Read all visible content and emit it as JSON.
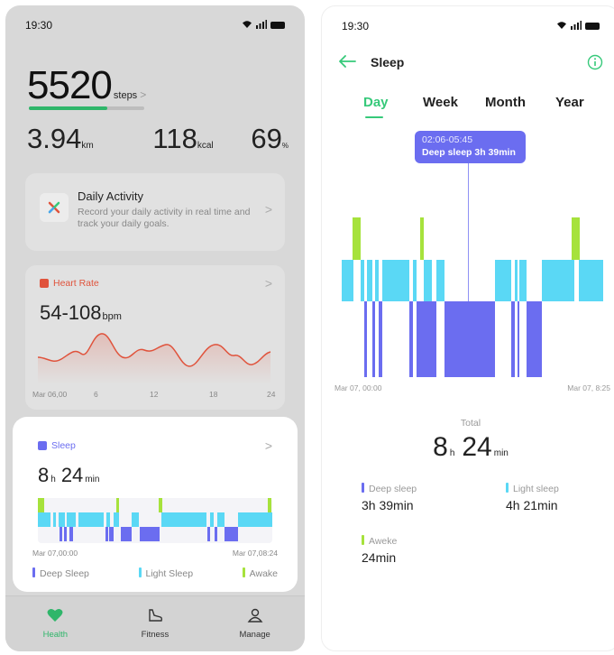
{
  "left": {
    "status": {
      "time": "19:30"
    },
    "summary": {
      "steps_value": "5520",
      "steps_unit": "steps",
      "steps_progress": 0.68,
      "distance_value": "3.94",
      "distance_unit": "km",
      "calories_value": "118",
      "calories_unit": "kcal",
      "percent_value": "69",
      "percent_unit": "%"
    },
    "daily_activity": {
      "title": "Daily Activity",
      "description": "Record your daily activity in real time and track your daily goals."
    },
    "heart_rate": {
      "title": "Heart Rate",
      "range_value": "54-108",
      "unit": "bpm",
      "x_ticks": [
        "Mar 06,00",
        "6",
        "12",
        "18",
        "24"
      ]
    },
    "sleep": {
      "title": "Sleep",
      "hours_value": "8",
      "hours_unit": "h",
      "minutes_value": "24",
      "minutes_unit": "min",
      "start_label": "Mar 07,00:00",
      "end_label": "Mar 07,08:24",
      "legend": [
        "Deep Sleep",
        "Light Sleep",
        "Awake"
      ]
    },
    "tabbar": {
      "health": "Health",
      "fitness": "Fitness",
      "manage": "Manage"
    }
  },
  "right": {
    "status": {
      "time": "19:30"
    },
    "title": "Sleep",
    "tabs": [
      "Day",
      "Week",
      "Month",
      "Year"
    ],
    "active_tab": "Day",
    "tooltip": {
      "time_range": "02:06-05:45",
      "text": "Deep sleep 3h 39min"
    },
    "axis_start": "Mar 07, 00:00",
    "axis_end": "Mar 07, 8:25",
    "total_label": "Total",
    "total_hours": "8",
    "total_hours_unit": "h",
    "total_minutes": "24",
    "total_minutes_unit": "min",
    "stats": {
      "deep_label": "Deep sleep",
      "deep_value": "3h 39min",
      "light_label": "Light sleep",
      "light_value": "4h 21min",
      "awake_label": "Aweke",
      "awake_value": "24min"
    }
  },
  "colors": {
    "deep": "#6b6df0",
    "light": "#5ad8f5",
    "awake": "#a6e23c",
    "accent_green": "#36c97a",
    "heart_red": "#e0533c"
  },
  "icons": {
    "back": "arrow-left-icon",
    "info": "info-icon",
    "health": "heart-icon",
    "fitness": "shoe-icon",
    "manage": "person-icon"
  }
}
